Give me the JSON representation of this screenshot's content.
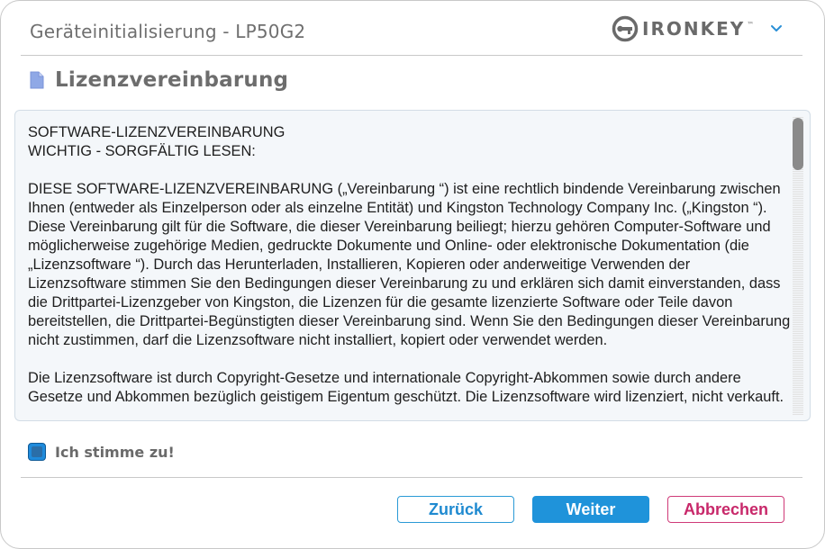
{
  "window": {
    "title": "Geräteinitialisierung - LP50G2",
    "logo_text": "IRONKEY",
    "logo_tm": "™"
  },
  "colors": {
    "accent": "#1f93da",
    "cancel": "#c8286a",
    "heading": "#6d6d6d"
  },
  "icons": {
    "menu": "chevron-down-icon",
    "document": "document-icon",
    "logo": "ironkey-key-icon"
  },
  "section": {
    "heading": "Lizenzvereinbarung"
  },
  "license": {
    "line1": "SOFTWARE-LIZENZVEREINBARUNG",
    "line2": "WICHTIG - SORGFÄLTIG LESEN:",
    "para1": "DIESE SOFTWARE-LIZENZVEREINBARUNG („Vereinbarung “) ist eine rechtlich bindende Vereinbarung zwischen Ihnen (entweder als Einzelperson oder als einzelne Entität) und Kingston Technology Company Inc. („Kingston “). Diese Vereinbarung gilt für die Software, die dieser Vereinbarung beiliegt; hierzu gehören Computer-Software und möglicherweise zugehörige Medien, gedruckte Dokumente und Online- oder elektronische Dokumentation (die „Lizenzsoftware “). Durch das Herunterladen, Installieren, Kopieren oder anderweitige Verwenden der Lizenzsoftware stimmen Sie den Bedingungen dieser Vereinbarung zu und erklären sich damit einverstanden, dass die Drittpartei-Lizenzgeber von Kingston, die Lizenzen für die gesamte lizenzierte Software oder Teile davon bereitstellen, die Drittpartei-Begünstigten dieser Vereinbarung sind. Wenn Sie den Bedingungen dieser Vereinbarung nicht zustimmen, darf die Lizenzsoftware nicht installiert, kopiert oder verwendet werden.",
    "para2": "Die Lizenzsoftware ist durch Copyright-Gesetze und internationale Copyright-Abkommen sowie durch andere Gesetze und Abkommen bezüglich geistigem Eigentum geschützt. Die Lizenzsoftware wird lizenziert, nicht verkauft."
  },
  "agreement": {
    "label": "Ich stimme zu!",
    "checked": true
  },
  "buttons": {
    "back": "Zurück",
    "next": "Weiter",
    "cancel": "Abbrechen"
  }
}
